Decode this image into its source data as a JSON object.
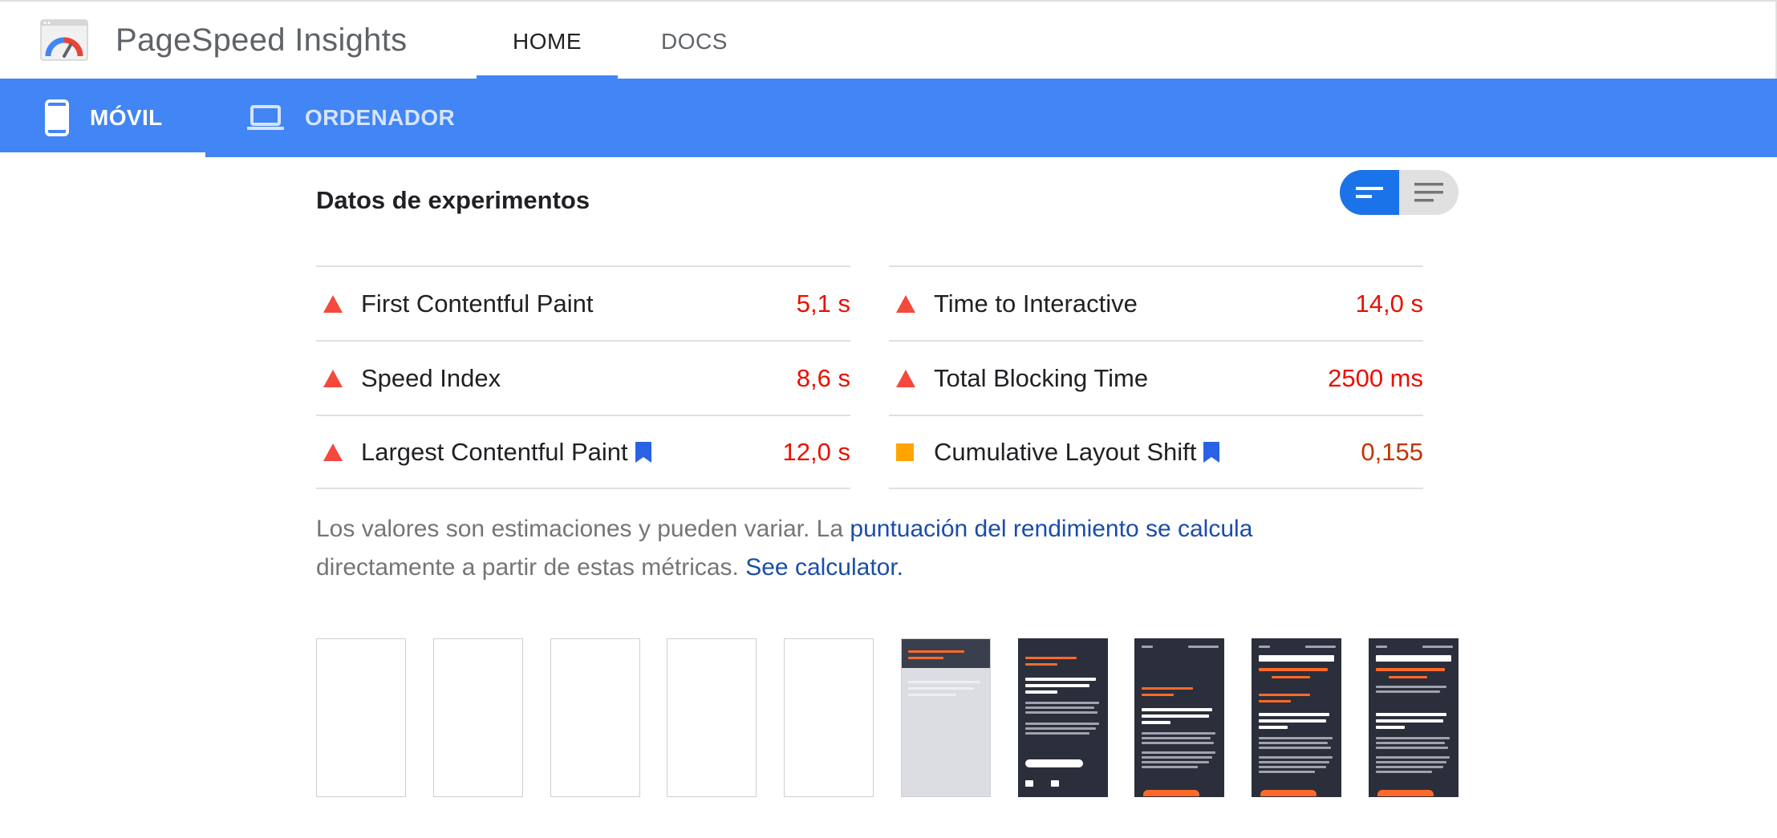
{
  "header": {
    "app_title": "PageSpeed Insights",
    "nav": [
      {
        "label": "HOME",
        "active": true
      },
      {
        "label": "DOCS",
        "active": false
      }
    ]
  },
  "device_tabs": [
    {
      "label": "MÓVIL",
      "icon": "smartphone-icon",
      "active": true
    },
    {
      "label": "ORDENADOR",
      "icon": "laptop-icon",
      "active": false
    }
  ],
  "lab": {
    "title": "Datos de experimentos",
    "toggle": {
      "expanded_icon": "compact-view-icon",
      "list_icon": "list-view-icon",
      "active": "compact"
    }
  },
  "metrics": {
    "left": [
      {
        "name": "First Contentful Paint",
        "value": "5,1 s",
        "status": "fail",
        "bookmark": false
      },
      {
        "name": "Speed Index",
        "value": "8,6 s",
        "status": "fail",
        "bookmark": false
      },
      {
        "name": "Largest Contentful Paint",
        "value": "12,0 s",
        "status": "fail",
        "bookmark": true
      }
    ],
    "right": [
      {
        "name": "Time to Interactive",
        "value": "14,0 s",
        "status": "fail",
        "bookmark": false
      },
      {
        "name": "Total Blocking Time",
        "value": "2500 ms",
        "status": "fail",
        "bookmark": false
      },
      {
        "name": "Cumulative Layout Shift",
        "value": "0,155",
        "status": "average",
        "bookmark": true
      }
    ]
  },
  "note": {
    "text1": "Los valores son estimaciones y pueden variar. La ",
    "link1": "puntuación del rendimiento se calcula",
    "text2": " directamente a partir de estas métricas. ",
    "link2": "See calculator."
  },
  "filmstrip": {
    "frames": [
      "blank",
      "blank",
      "blank",
      "blank",
      "blank",
      "partial",
      "content",
      "content",
      "full",
      "full"
    ]
  },
  "colors": {
    "brand_blue": "#4285f4",
    "fail_red": "#eb0f00",
    "average_orange": "#ffa400",
    "link_blue": "#1a4dab"
  }
}
